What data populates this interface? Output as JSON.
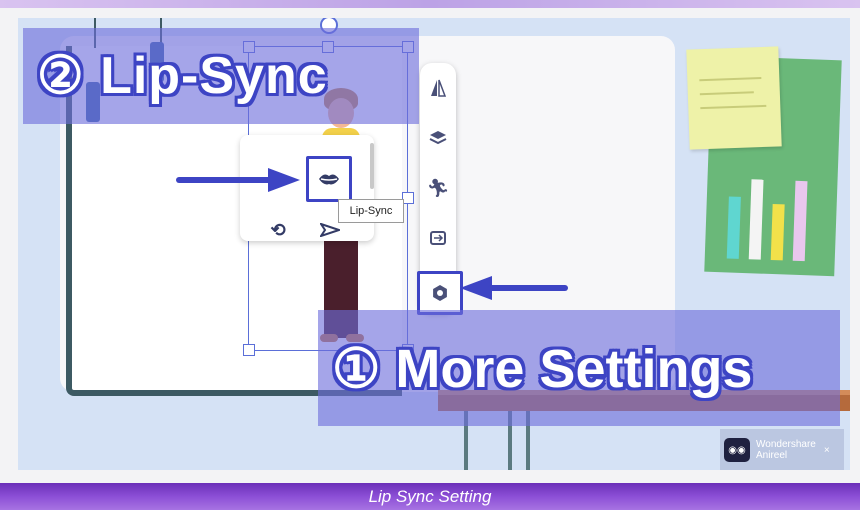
{
  "banners": {
    "step2": "② Lip-Sync",
    "step1": "① More Settings"
  },
  "tooltip": {
    "lip_sync": "Lip-Sync"
  },
  "brand": {
    "name_line1": "Wondershare",
    "name_line2": "Anireel",
    "close": "×"
  },
  "caption": {
    "text": "Lip Sync Setting"
  },
  "toolbar": {
    "icons": [
      "flip-icon",
      "layers-icon",
      "action-icon",
      "replace-icon",
      "more-settings-icon"
    ]
  },
  "floating_panel": {
    "icons": [
      "lips-icon",
      "sync-icon",
      "send-icon"
    ]
  },
  "colors": {
    "highlight": "#3d44c4",
    "banner": "#6e6edc",
    "caption_bar": "#8c4fd6",
    "desk": "#b56a3c",
    "board": "#6ab879"
  }
}
